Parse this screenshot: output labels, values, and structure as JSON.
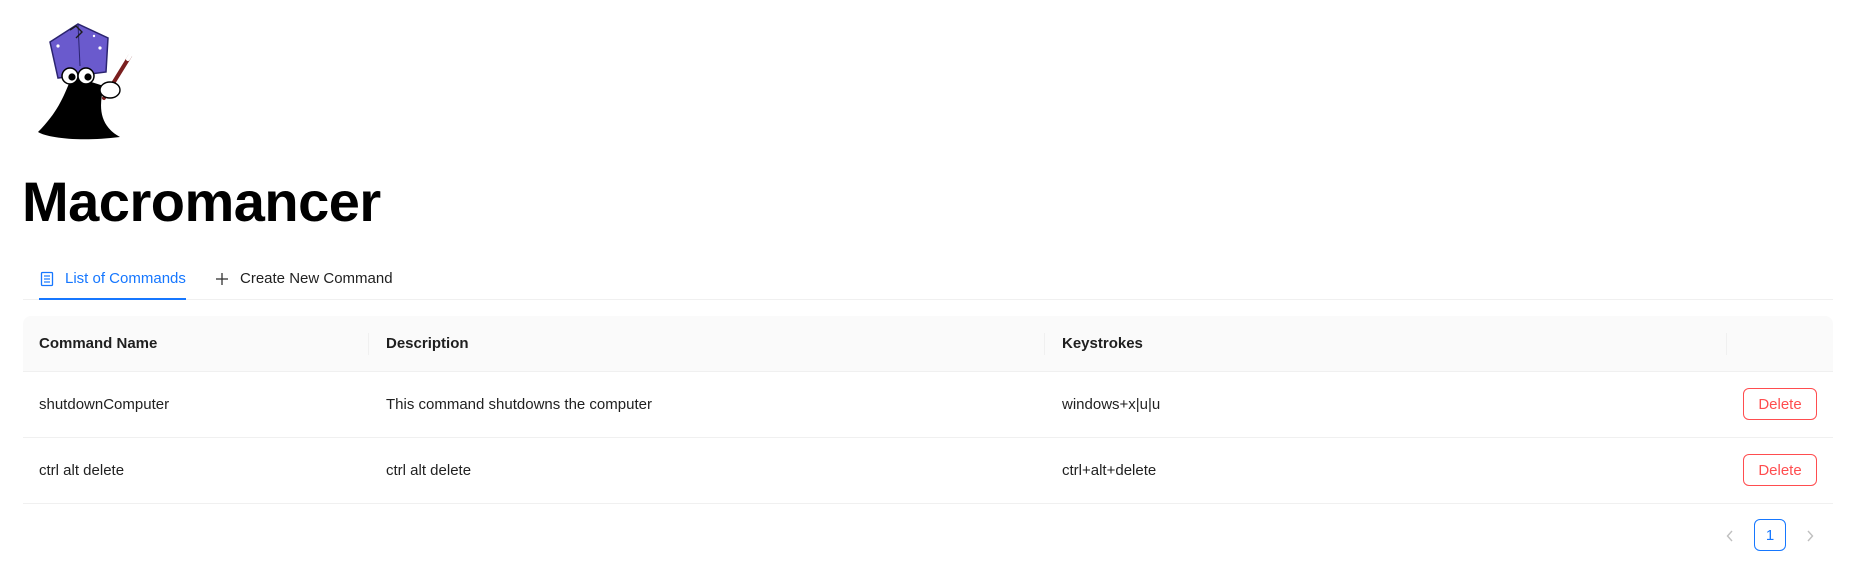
{
  "app": {
    "title": "Macromancer",
    "logo": "wizard-mascot-logo"
  },
  "tabs": [
    {
      "label": "List of Commands",
      "icon": "list-icon",
      "active": true
    },
    {
      "label": "Create New Command",
      "icon": "plus-icon",
      "active": false
    }
  ],
  "table": {
    "columns": [
      "Command Name",
      "Description",
      "Keystrokes",
      ""
    ],
    "rows": [
      {
        "name": "shutdownComputer",
        "description": "This command shutdowns the computer",
        "keystrokes": "windows+x|u|u",
        "action": "Delete"
      },
      {
        "name": "ctrl alt delete",
        "description": "ctrl alt delete",
        "keystrokes": "ctrl+alt+delete",
        "action": "Delete"
      }
    ]
  },
  "pagination": {
    "current_page": "1",
    "prev_icon": "chevron-left-icon",
    "next_icon": "chevron-right-icon"
  },
  "colors": {
    "accent": "#1677ff",
    "danger": "#ff4d4f",
    "logo_hat": "#6a5acd",
    "logo_body": "#000000"
  }
}
